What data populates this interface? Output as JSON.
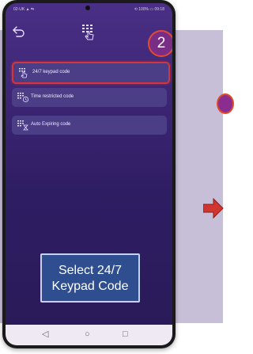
{
  "status_bar": {
    "left": "02-UK ▲ ⇆",
    "right": "⟲ 100% ▭ 09:18"
  },
  "step_number": "2",
  "menu_items": [
    {
      "label": "24/7 keypad code",
      "icon": "keypad-hand-icon",
      "selected": true
    },
    {
      "label": "Time restricted code",
      "icon": "keypad-clock-icon",
      "selected": false
    },
    {
      "label": "Auto Expiring code",
      "icon": "keypad-hourglass-icon",
      "selected": false
    }
  ],
  "callout": {
    "line1": "Select 24/7",
    "line2": "Keypad Code"
  },
  "nav_buttons": {
    "back": "◁",
    "home": "○",
    "recent": "□"
  },
  "colors": {
    "selection_border": "#d2363b",
    "badge_fill": "#7a2d86",
    "arrow": "#d0352f"
  }
}
